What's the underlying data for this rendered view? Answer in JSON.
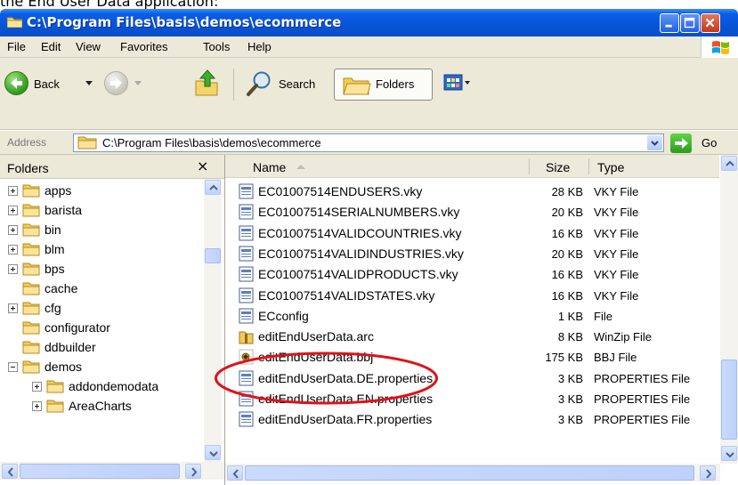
{
  "caption": "the End User Data application:",
  "window": {
    "title": "C:\\Program Files\\basis\\demos\\ecommerce",
    "minimize_icon": "minimize-icon",
    "maximize_icon": "maximize-icon",
    "close_icon": "close-icon"
  },
  "menu": {
    "items": [
      "File",
      "Edit",
      "View",
      "Favorites",
      "Tools",
      "Help"
    ]
  },
  "toolbar": {
    "back_label": "Back",
    "search_label": "Search",
    "folders_label": "Folders"
  },
  "address": {
    "label": "Address",
    "value": "C:\\Program Files\\basis\\demos\\ecommerce",
    "go_label": "Go"
  },
  "folders": {
    "title": "Folders",
    "close": "×",
    "items": [
      {
        "label": "apps",
        "expander": "plus"
      },
      {
        "label": "barista",
        "expander": "plus"
      },
      {
        "label": "bin",
        "expander": "plus"
      },
      {
        "label": "blm",
        "expander": "plus"
      },
      {
        "label": "bps",
        "expander": "plus"
      },
      {
        "label": "cache",
        "expander": "none"
      },
      {
        "label": "cfg",
        "expander": "plus"
      },
      {
        "label": "configurator",
        "expander": "none"
      },
      {
        "label": "ddbuilder",
        "expander": "none"
      },
      {
        "label": "demos",
        "expander": "minus"
      },
      {
        "label": "addondemodata",
        "expander": "plus"
      },
      {
        "label": "AreaCharts",
        "expander": "plus"
      }
    ]
  },
  "files": {
    "columns": {
      "name": "Name",
      "size": "Size",
      "type": "Type"
    },
    "rows": [
      {
        "name": "EC01007514ENDUSERS.vky",
        "size": "28 KB",
        "type": "VKY File",
        "icon": "vky-file-icon"
      },
      {
        "name": "EC01007514SERIALNUMBERS.vky",
        "size": "20 KB",
        "type": "VKY File",
        "icon": "vky-file-icon"
      },
      {
        "name": "EC01007514VALIDCOUNTRIES.vky",
        "size": "16 KB",
        "type": "VKY File",
        "icon": "vky-file-icon"
      },
      {
        "name": "EC01007514VALIDINDUSTRIES.vky",
        "size": "20 KB",
        "type": "VKY File",
        "icon": "vky-file-icon"
      },
      {
        "name": "EC01007514VALIDPRODUCTS.vky",
        "size": "16 KB",
        "type": "VKY File",
        "icon": "vky-file-icon"
      },
      {
        "name": "EC01007514VALIDSTATES.vky",
        "size": "16 KB",
        "type": "VKY File",
        "icon": "vky-file-icon"
      },
      {
        "name": "ECconfig",
        "size": "1 KB",
        "type": "File",
        "icon": "generic-file-icon"
      },
      {
        "name": "editEndUserData.arc",
        "size": "8 KB",
        "type": "WinZip File",
        "icon": "winzip-file-icon"
      },
      {
        "name": "editEndUserData.bbj",
        "size": "175 KB",
        "type": "BBJ File",
        "icon": "bbj-file-icon"
      },
      {
        "name": "editEndUserData.DE.properties",
        "size": "3 KB",
        "type": "PROPERTIES File",
        "icon": "properties-file-icon"
      },
      {
        "name": "editEndUserData.EN.properties",
        "size": "3 KB",
        "type": "PROPERTIES File",
        "icon": "properties-file-icon"
      },
      {
        "name": "editEndUserData.FR.properties",
        "size": "3 KB",
        "type": "PROPERTIES File",
        "icon": "properties-file-icon"
      }
    ]
  },
  "highlight": {
    "color": "#e0121b",
    "target": "editEndUserData.bbj"
  },
  "colors": {
    "titlebar": "#0754d6",
    "chrome": "#ece9d8",
    "highlight": "#e0121b"
  }
}
